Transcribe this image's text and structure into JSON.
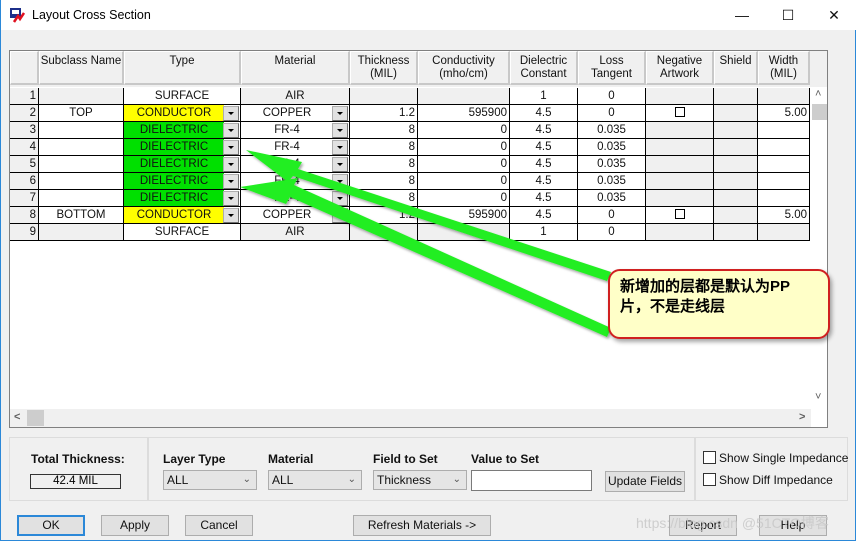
{
  "window": {
    "title": "Layout Cross Section",
    "minimize": "—",
    "maximize": "☐",
    "close": "✕"
  },
  "grid": {
    "columns": [
      {
        "key": "num",
        "label": ""
      },
      {
        "key": "subclass",
        "label": "Subclass Name"
      },
      {
        "key": "type",
        "label": "Type"
      },
      {
        "key": "material",
        "label": "Material"
      },
      {
        "key": "thickness",
        "label": "Thickness\n(MIL)"
      },
      {
        "key": "conductivity",
        "label": "Conductivity\n(mho/cm)"
      },
      {
        "key": "dielectric",
        "label": "Dielectric\nConstant"
      },
      {
        "key": "loss",
        "label": "Loss\nTangent"
      },
      {
        "key": "negative",
        "label": "Negative\nArtwork"
      },
      {
        "key": "shield",
        "label": "Shield"
      },
      {
        "key": "width",
        "label": "Width\n(MIL)"
      }
    ],
    "rows": [
      {
        "num": "1",
        "subclass": "",
        "type": "SURFACE",
        "material": "AIR",
        "thickness": "",
        "conductivity": "",
        "dielectric": "1",
        "loss": "0",
        "negative": false,
        "negative_checkbox": false,
        "shield": "",
        "width": ""
      },
      {
        "num": "2",
        "subclass": "TOP",
        "type": "CONDUCTOR",
        "material": "COPPER",
        "thickness": "1.2",
        "conductivity": "595900",
        "dielectric": "4.5",
        "loss": "0",
        "negative_checkbox": true,
        "shield": "",
        "width": "5.00"
      },
      {
        "num": "3",
        "subclass": "",
        "type": "DIELECTRIC",
        "material": "FR-4",
        "thickness": "8",
        "conductivity": "0",
        "dielectric": "4.5",
        "loss": "0.035",
        "negative_checkbox": false,
        "shield": "",
        "width": ""
      },
      {
        "num": "4",
        "subclass": "",
        "type": "DIELECTRIC",
        "material": "FR-4",
        "thickness": "8",
        "conductivity": "0",
        "dielectric": "4.5",
        "loss": "0.035",
        "negative_checkbox": false,
        "shield": "",
        "width": ""
      },
      {
        "num": "5",
        "subclass": "",
        "type": "DIELECTRIC",
        "material": "FR-4",
        "thickness": "8",
        "conductivity": "0",
        "dielectric": "4.5",
        "loss": "0.035",
        "negative_checkbox": false,
        "shield": "",
        "width": ""
      },
      {
        "num": "6",
        "subclass": "",
        "type": "DIELECTRIC",
        "material": "FR-4",
        "thickness": "8",
        "conductivity": "0",
        "dielectric": "4.5",
        "loss": "0.035",
        "negative_checkbox": false,
        "shield": "",
        "width": ""
      },
      {
        "num": "7",
        "subclass": "",
        "type": "DIELECTRIC",
        "material": "FR-4",
        "thickness": "8",
        "conductivity": "0",
        "dielectric": "4.5",
        "loss": "0.035",
        "negative_checkbox": false,
        "shield": "",
        "width": ""
      },
      {
        "num": "8",
        "subclass": "BOTTOM",
        "type": "CONDUCTOR",
        "material": "COPPER",
        "thickness": "1.2",
        "conductivity": "595900",
        "dielectric": "4.5",
        "loss": "0",
        "negative_checkbox": true,
        "shield": "",
        "width": "5.00"
      },
      {
        "num": "9",
        "subclass": "",
        "type": "SURFACE",
        "material": "AIR",
        "thickness": "",
        "conductivity": "",
        "dielectric": "1",
        "loss": "0",
        "negative_checkbox": false,
        "shield": "",
        "width": ""
      }
    ],
    "type_colors": {
      "CONDUCTOR": "#ffff00",
      "DIELECTRIC": "#00e000",
      "SURFACE": "#ffffff"
    },
    "scroll_up": "˄",
    "scroll_down": "˅",
    "scroll_left": "<",
    "scroll_right": ">"
  },
  "bottom": {
    "total_thickness_label": "Total Thickness:",
    "total_thickness_value": "42.4 MIL",
    "layer_type_label": "Layer Type",
    "layer_type_value": "ALL",
    "material_label": "Material",
    "material_value": "ALL",
    "field_to_set_label": "Field to Set",
    "field_to_set_value": "Thickness",
    "value_to_set_label": "Value to Set",
    "value_to_set_value": "",
    "update_fields": "Update Fields",
    "show_single_impedance": "Show Single Impedance",
    "show_diff_impedance": "Show Diff Impedance",
    "show_single_checked": false,
    "show_diff_checked": false
  },
  "buttons": {
    "ok": "OK",
    "apply": "Apply",
    "cancel": "Cancel",
    "refresh_materials": "Refresh Materials ->",
    "report": "Report",
    "help": "Help"
  },
  "annotation": {
    "callout_text": "新增加的层都是默认为PP片，不是走线层",
    "arrow_color": "#22ee22",
    "border_color": "#d02020",
    "fill_color": "#ffffc8"
  },
  "watermark": "https://blog.csdn @51CTO博客"
}
